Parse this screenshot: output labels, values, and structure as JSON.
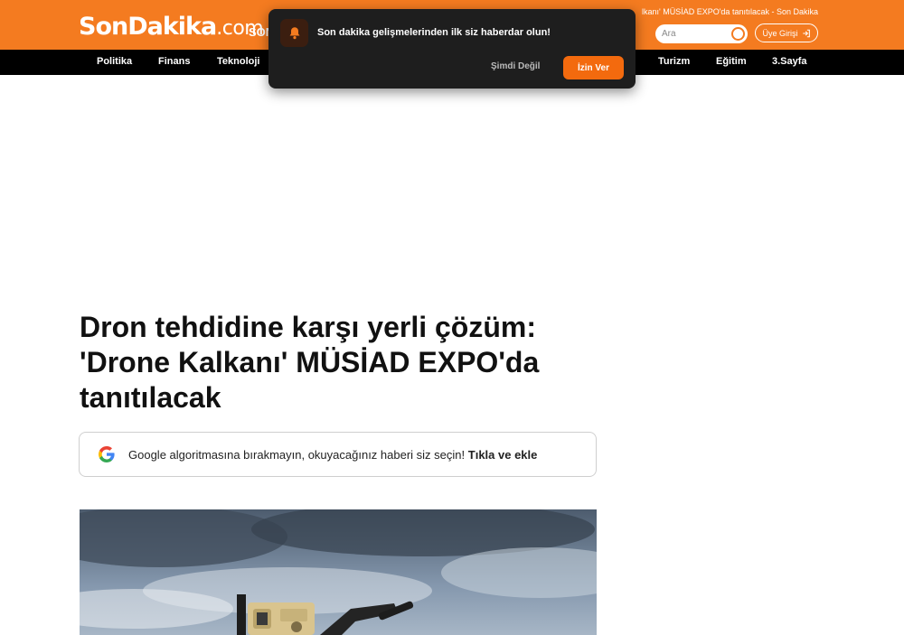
{
  "header": {
    "logo_main": "SonDakika",
    "logo_domain": ".com",
    "partial_nav": "SON",
    "ticker": "lkanı' MÜSİAD EXPO'da tanıtılacak - Son Dakika",
    "search_placeholder": "Ara",
    "login_label": "Üye Girişi"
  },
  "categories": [
    {
      "label": "Politika"
    },
    {
      "label": "Finans"
    },
    {
      "label": "Teknoloji"
    },
    {
      "label": "Turizm"
    },
    {
      "label": "Eğitim"
    },
    {
      "label": "3.Sayfa"
    }
  ],
  "notification": {
    "message": "Son dakika gelişmelerinden ilk siz haberdar olun!",
    "later_label": "Şimdi Değil",
    "allow_label": "İzin Ver"
  },
  "article": {
    "headline_lines": [
      "Dron tehdidine karşı yerli çözüm:",
      "'Drone Kalkanı' MÜSİAD EXPO'da",
      "tanıtılacak"
    ],
    "google_prompt": "Google algoritmasına bırakmayın, okuyacağınız haberi siz seçin!",
    "google_cta": "Tıkla ve ekle"
  },
  "colors": {
    "brand_orange": "#f47b20",
    "nav_black": "#000000",
    "notification_bg": "#1e1e1e",
    "allow_button": "#f36a0e"
  },
  "icons": [
    "bell-icon",
    "search-icon",
    "login-arrow-icon",
    "google-g-icon"
  ]
}
